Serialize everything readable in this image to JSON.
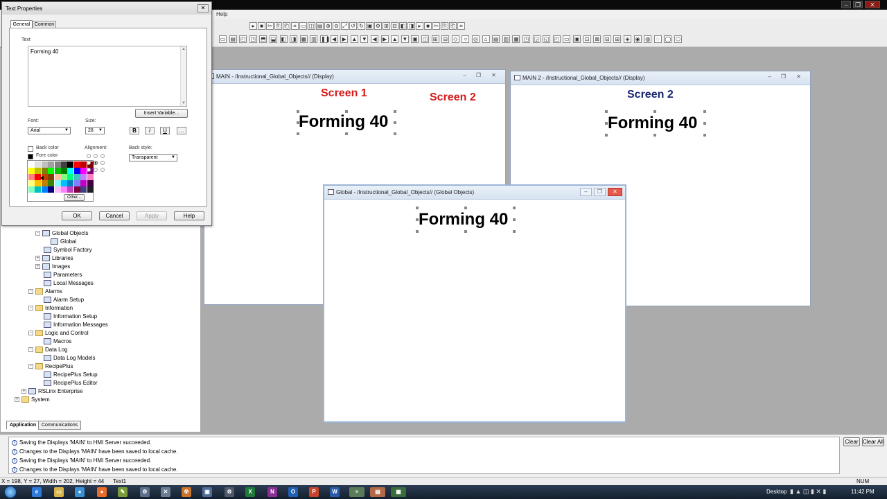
{
  "menubar": {
    "help": "Help"
  },
  "explorer": {
    "items": [
      {
        "label": "Global Objects",
        "level": 2,
        "expander": "-",
        "icon": "display-icon"
      },
      {
        "label": "Global",
        "level": 3,
        "icon": "display-icon"
      },
      {
        "label": "Symbol Factory",
        "level": 2,
        "icon": "symbol-factory-icon"
      },
      {
        "label": "Libraries",
        "level": 2,
        "expander": "+",
        "icon": "library-icon"
      },
      {
        "label": "Images",
        "level": 2,
        "expander": "+",
        "icon": "image-icon"
      },
      {
        "label": "Parameters",
        "level": 2,
        "icon": "parameters-icon"
      },
      {
        "label": "Local Messages",
        "level": 2,
        "icon": "local-messages-icon"
      },
      {
        "label": "Alarms",
        "level": 1,
        "expander": "-",
        "icon": "folder-icon"
      },
      {
        "label": "Alarm Setup",
        "level": 2,
        "icon": "alarm-setup-icon"
      },
      {
        "label": "Information",
        "level": 1,
        "expander": "-",
        "icon": "folder-icon"
      },
      {
        "label": "Information Setup",
        "level": 2,
        "icon": "information-setup-icon"
      },
      {
        "label": "Information Messages",
        "level": 2,
        "icon": "information-messages-icon"
      },
      {
        "label": "Logic and Control",
        "level": 1,
        "expander": "-",
        "icon": "folder-icon"
      },
      {
        "label": "Macros",
        "level": 2,
        "icon": "macros-icon"
      },
      {
        "label": "Data Log",
        "level": 1,
        "expander": "-",
        "icon": "folder-icon"
      },
      {
        "label": "Data Log Models",
        "level": 2,
        "icon": "data-log-icon"
      },
      {
        "label": "RecipePlus",
        "level": 1,
        "expander": "-",
        "icon": "folder-icon"
      },
      {
        "label": "RecipePlus Setup",
        "level": 2,
        "icon": "recipe-setup-icon"
      },
      {
        "label": "RecipePlus Editor",
        "level": 2,
        "icon": "recipe-editor-icon"
      },
      {
        "label": "RSLinx Enterprise",
        "level": 0,
        "expander": "+",
        "icon": "rslinx-icon"
      },
      {
        "label": "System",
        "level": -1,
        "expander": "+",
        "icon": "folder-icon"
      }
    ],
    "tabs": {
      "application": "Application",
      "communications": "Communications"
    }
  },
  "dialog": {
    "title": "Text Properties",
    "tabs": {
      "general": "General",
      "common": "Common"
    },
    "text_label": "Text",
    "text_value": "Forming 40",
    "insert_variable": "Insert Variable...",
    "font_label": "Font:",
    "font_value": "Arial",
    "size_label": "Size:",
    "size_value": "28",
    "bold": "B",
    "italic": "I",
    "underline": "U",
    "more": "...",
    "back_color_label": "Back color",
    "fore_color_label": "Fore color",
    "alignment_label": "Alignment:",
    "back_style_label": "Back style:",
    "back_style_value": "Transparent",
    "other_button": "Other...",
    "ok": "OK",
    "cancel": "Cancel",
    "apply": "Apply",
    "help": "Help"
  },
  "windows": {
    "main": {
      "title": "MAIN - /Instructional_Global_Objects// (Display)",
      "screen1": "Screen 1",
      "screen2": "Screen 2",
      "object_text": "Forming 40"
    },
    "main2": {
      "title": "MAIN 2 - /Instructional_Global_Objects// (Display)",
      "screen2": "Screen 2",
      "object_text": "Forming 40"
    },
    "global": {
      "title": "Global - /Instructional_Global_Objects// (Global Objects)",
      "object_text": "Forming 40"
    }
  },
  "output": {
    "messages": [
      "Saving the Displays 'MAIN' to HMI Server succeeded.",
      "Changes to the Displays 'MAIN' have been saved to local cache.",
      "Saving the Displays 'MAIN' to HMI Server succeeded.",
      "Changes to the Displays 'MAIN' have been saved to local cache."
    ],
    "clear": "Clear",
    "clear_all": "Clear All"
  },
  "statusbar": {
    "position": "X = 198, Y = 27, Width = 202, Height = 44",
    "object": "Text1",
    "num": "NUM"
  },
  "taskbar": {
    "desktop": "Desktop",
    "time": "11:42 PM"
  },
  "colors": {
    "screen1_label": "#d31b1b",
    "screen2_main_label": "#d31b1b",
    "screen2_main2_label": "#16246e",
    "fore_color": "#000000"
  },
  "palette": [
    [
      "#ffffff",
      "#e0e0e0",
      "#c0c0c0",
      "#a0a0a0",
      "#808080",
      "#404040",
      "#000000",
      "#ff0000",
      "#c00000",
      "#800000"
    ],
    [
      "#ffff00",
      "#c0c000",
      "#808000",
      "#00ff00",
      "#00c000",
      "#008000",
      "#00ffff",
      "#0000ff",
      "#ff00ff",
      "#800080"
    ],
    [
      "#ff8080",
      "#ff0000",
      "#c04000",
      "#804000",
      "#ffc0a0",
      "#80ff80",
      "#00ff80",
      "#40c0c0",
      "#c080ff",
      "#ff80c0"
    ],
    [
      "#ffff80",
      "#ffc000",
      "#c08000",
      "#408000",
      "#80ffff",
      "#00c0ff",
      "#0080c0",
      "#8080ff",
      "#c000c0",
      "#400040"
    ],
    [
      "#80ffc0",
      "#00c0c0",
      "#0080ff",
      "#000080",
      "#ffc0ff",
      "#ff80ff",
      "#c040c0",
      "#800040",
      "#404080",
      "#202020"
    ]
  ]
}
